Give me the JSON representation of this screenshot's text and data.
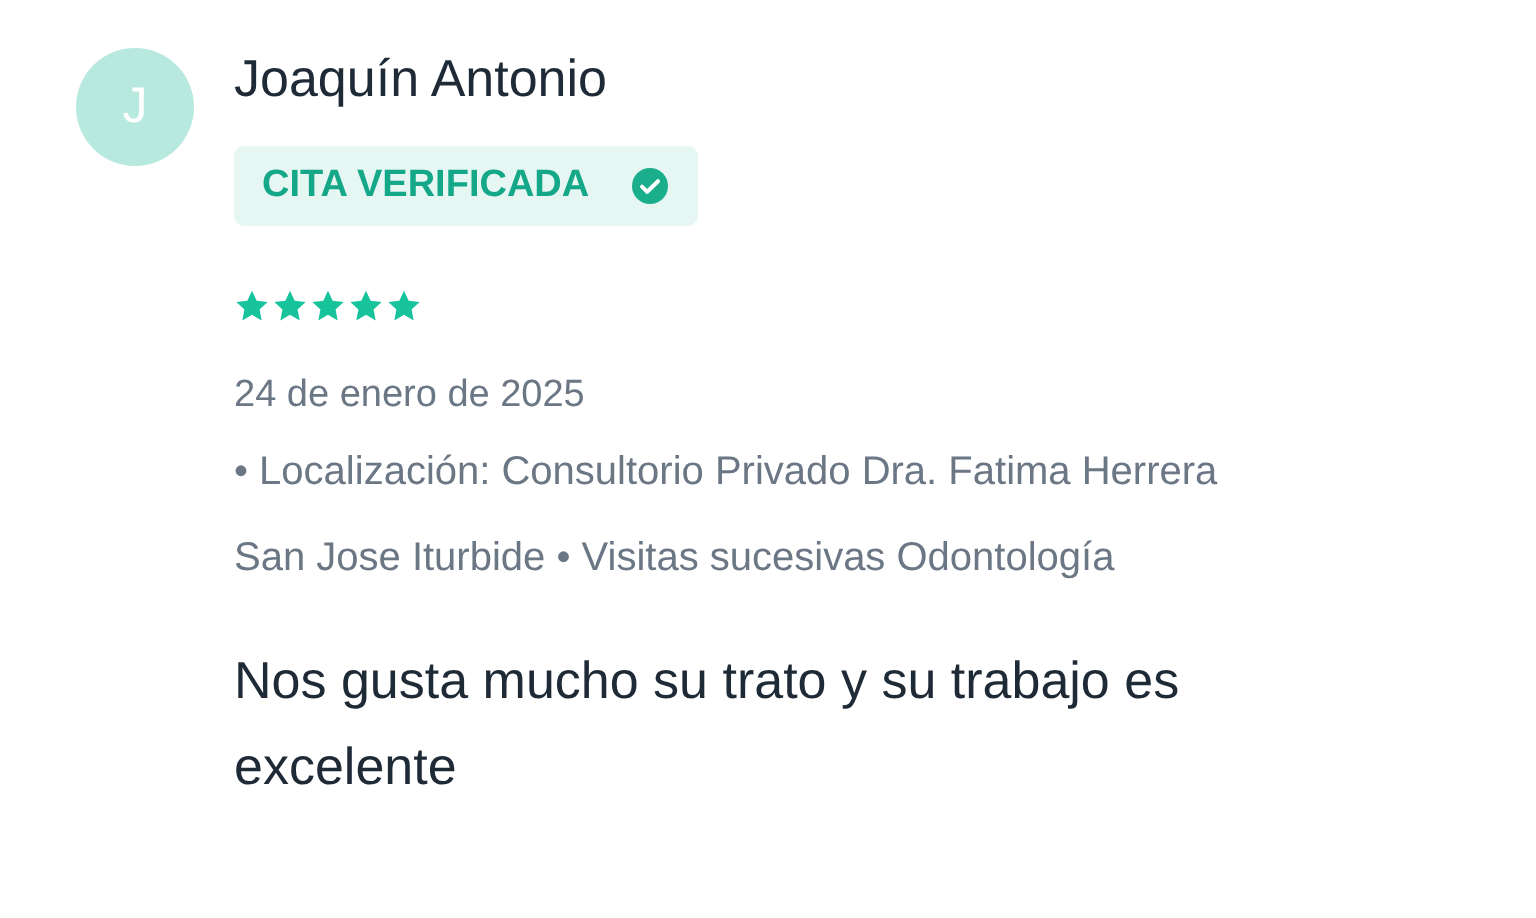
{
  "review": {
    "avatar_initial": "J",
    "author": "Joaquín Antonio",
    "badge": {
      "label": "CITA VERIFICADA",
      "verified": true
    },
    "stars": 5,
    "date": "24 de enero de 2025",
    "details": [
      "• Localización: Consultorio Privado Dra. Fatima Herrera San Jose Iturbide",
      "• Visitas sucesivas Odontología"
    ],
    "comment": "Nos gusta mucho su trato y su trabajo es excelente"
  }
}
